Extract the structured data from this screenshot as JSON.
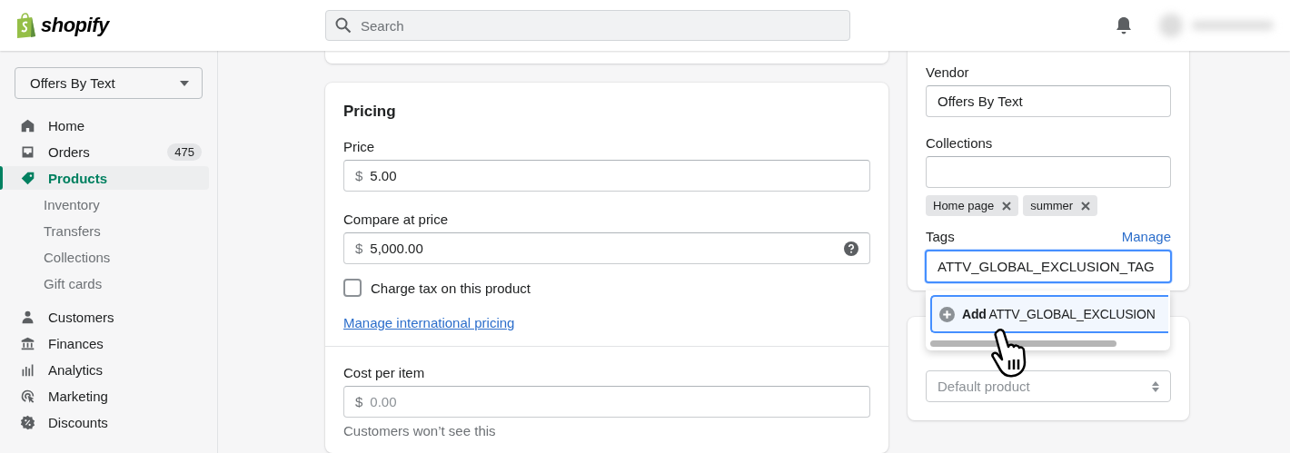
{
  "header": {
    "logo_text": "shopify",
    "search": {
      "placeholder": "Search"
    }
  },
  "sidebar": {
    "store_selector": "Offers By Text",
    "items": [
      {
        "label": "Home",
        "selected": false
      },
      {
        "label": "Orders",
        "selected": false,
        "badge": "475"
      },
      {
        "label": "Products",
        "selected": true,
        "children": [
          {
            "label": "Inventory"
          },
          {
            "label": "Transfers"
          },
          {
            "label": "Collections"
          },
          {
            "label": "Gift cards"
          }
        ]
      },
      {
        "label": "Customers",
        "selected": false
      },
      {
        "label": "Finances",
        "selected": false
      },
      {
        "label": "Analytics",
        "selected": false
      },
      {
        "label": "Marketing",
        "selected": false
      },
      {
        "label": "Discounts",
        "selected": false
      }
    ]
  },
  "pricing": {
    "title": "Pricing",
    "price": {
      "label": "Price",
      "prefix": "$",
      "value": "5.00"
    },
    "compare_at_price": {
      "label": "Compare at price",
      "prefix": "$",
      "value": "5,000.00"
    },
    "charge_tax": {
      "label": "Charge tax on this product",
      "checked": false
    },
    "link": "Manage international pricing",
    "cost_per_item": {
      "label": "Cost per item",
      "prefix": "$",
      "placeholder": "0.00",
      "help": "Customers won’t see this"
    }
  },
  "organization": {
    "vendor": {
      "label": "Vendor",
      "value": "Offers By Text"
    },
    "collections": {
      "label": "Collections",
      "chips": [
        "Home page",
        "summer"
      ]
    },
    "tags": {
      "label": "Tags",
      "action": "Manage",
      "value": "ATTV_GLOBAL_EXCLUSION_TAG"
    },
    "suggestion": {
      "action": "Add",
      "text": "ATTV_GLOBAL_EXCLUSION"
    }
  },
  "template": {
    "placeholder": "Default product"
  }
}
